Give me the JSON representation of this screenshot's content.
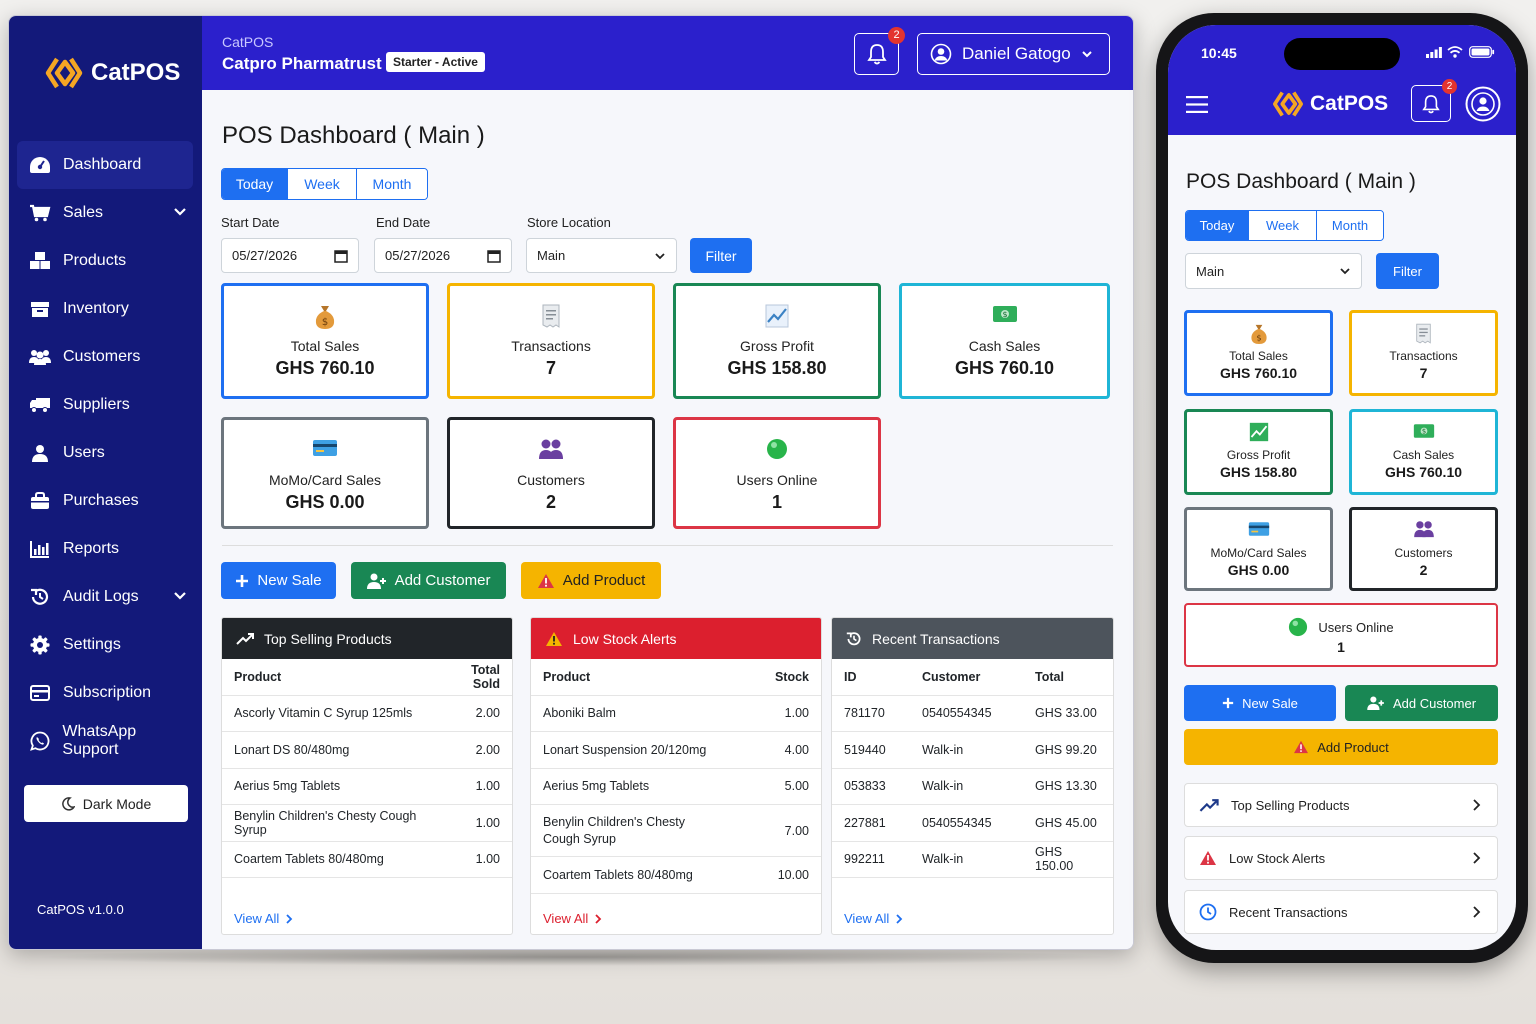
{
  "app": {
    "name": "CatPOS",
    "version": "CatPOS v1.0.0"
  },
  "topbar": {
    "app_label": "CatPOS",
    "store_name": "Catpro Pharmatrust",
    "plan_badge": "Starter - Active",
    "notif_count": "2",
    "user_name": "Daniel Gatogo"
  },
  "sidebar": {
    "items": [
      {
        "label": "Dashboard",
        "icon": "dashboard-icon"
      },
      {
        "label": "Sales",
        "icon": "cart-icon"
      },
      {
        "label": "Products",
        "icon": "boxes-icon"
      },
      {
        "label": "Inventory",
        "icon": "inventory-icon"
      },
      {
        "label": "Customers",
        "icon": "users-icon"
      },
      {
        "label": "Suppliers",
        "icon": "truck-icon"
      },
      {
        "label": "Users",
        "icon": "user-icon"
      },
      {
        "label": "Purchases",
        "icon": "bag-icon"
      },
      {
        "label": "Reports",
        "icon": "chart-icon"
      },
      {
        "label": "Audit Logs",
        "icon": "history-icon"
      },
      {
        "label": "Settings",
        "icon": "gear-icon"
      },
      {
        "label": "Subscription",
        "icon": "credit-card-icon"
      },
      {
        "label": "WhatsApp Support",
        "icon": "whatsapp-icon"
      }
    ],
    "dark_mode_label": "Dark Mode"
  },
  "dashboard": {
    "title": "POS Dashboard ( Main )",
    "periods": [
      "Today",
      "Week",
      "Month"
    ],
    "active_period": "Today",
    "start_date_label": "Start Date",
    "start_date": "05/27/2026",
    "end_date_label": "End Date",
    "end_date": "05/27/2026",
    "store_location_label": "Store Location",
    "store_location": "Main",
    "filter_label": "Filter",
    "cards": [
      {
        "title": "Total Sales",
        "value": "GHS 760.10",
        "color": "#1e6ff1"
      },
      {
        "title": "Transactions",
        "value": "7",
        "color": "#f5b400"
      },
      {
        "title": "Gross Profit",
        "value": "GHS 158.80",
        "color": "#198754"
      },
      {
        "title": "Cash Sales",
        "value": "GHS 760.10",
        "color": "#1fb5d6"
      },
      {
        "title": "MoMo/Card Sales",
        "value": "GHS 0.00",
        "color": "#6c757d"
      },
      {
        "title": "Customers",
        "value": "2",
        "color": "#212529"
      },
      {
        "title": "Users Online",
        "value": "1",
        "color": "#dc3545"
      }
    ],
    "actions": {
      "new_sale": "New Sale",
      "add_customer": "Add Customer",
      "add_product": "Add Product"
    },
    "top_selling": {
      "title": "Top Selling Products",
      "headers": [
        "Product",
        "Total Sold"
      ],
      "rows": [
        [
          "Ascorly Vitamin C Syrup 125mls",
          "2.00"
        ],
        [
          "Lonart DS 80/480mg",
          "2.00"
        ],
        [
          "Aerius 5mg Tablets",
          "1.00"
        ],
        [
          "Benylin Children's Chesty Cough Syrup",
          "1.00"
        ],
        [
          "Coartem Tablets 80/480mg",
          "1.00"
        ]
      ],
      "view_all": "View All"
    },
    "low_stock": {
      "title": "Low Stock Alerts",
      "headers": [
        "Product",
        "Stock"
      ],
      "rows": [
        [
          "Aboniki Balm",
          "1.00"
        ],
        [
          "Lonart Suspension 20/120mg",
          "4.00"
        ],
        [
          "Aerius 5mg Tablets",
          "5.00"
        ],
        [
          "Benylin Children's Chesty Cough Syrup",
          "7.00"
        ],
        [
          "Coartem Tablets 80/480mg",
          "10.00"
        ]
      ],
      "view_all": "View All"
    },
    "recent": {
      "title": "Recent Transactions",
      "headers": [
        "ID",
        "Customer",
        "Total"
      ],
      "rows": [
        [
          "781170",
          "0540554345",
          "GHS 33.00"
        ],
        [
          "519440",
          "Walk-in",
          "GHS 99.20"
        ],
        [
          "053833",
          "Walk-in",
          "GHS 13.30"
        ],
        [
          "227881",
          "0540554345",
          "GHS 45.00"
        ],
        [
          "992211",
          "Walk-in",
          "GHS 150.00"
        ]
      ],
      "view_all": "View All"
    }
  },
  "mobile": {
    "time": "10:45",
    "notif_count": "2",
    "title": "POS Dashboard ( Main )",
    "store_location": "Main",
    "filter_label": "Filter",
    "list": [
      "Top Selling Products",
      "Low Stock Alerts",
      "Recent Transactions"
    ]
  }
}
